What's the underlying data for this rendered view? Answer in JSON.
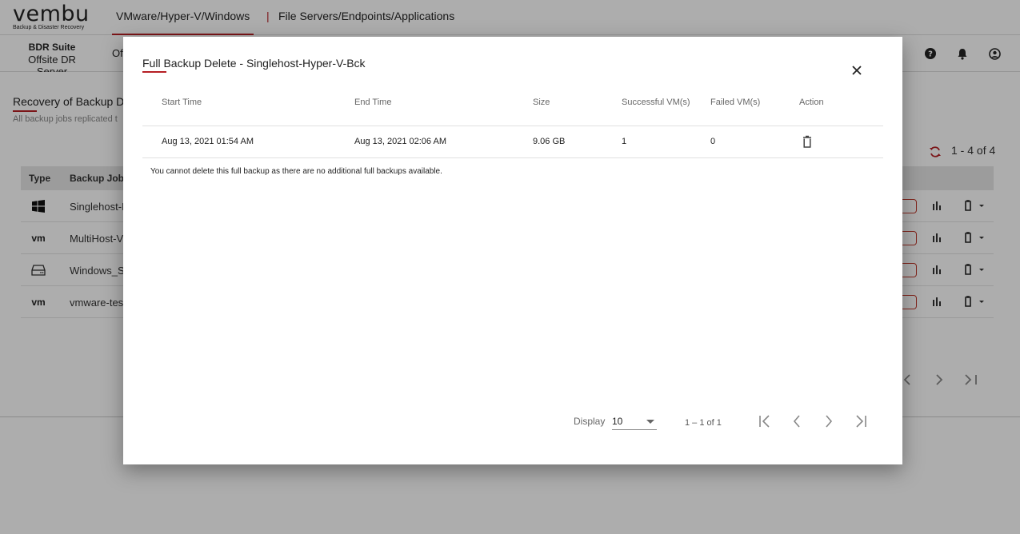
{
  "topbar": {
    "logo_word": "vembu",
    "logo_tagline": "Backup & Disaster Recovery",
    "nav_active": "VMware/Hyper-V/Windows",
    "nav_separator": "|",
    "nav_other": "File Servers/Endpoints/Applications"
  },
  "subbar": {
    "product_title": "BDR Suite",
    "product_subtitle": "Offsite DR Server",
    "tab_partial": "Of",
    "icons": [
      "help-icon",
      "bell-icon",
      "user-icon"
    ]
  },
  "background_page": {
    "title_partial": "Recovery of Backup Da",
    "subtitle_partial": "All backup jobs replicated t",
    "count_text": "1 - 4 of 4",
    "columns": [
      "Type",
      "Backup Job N"
    ],
    "rows": [
      {
        "type_icon": "windows-icon",
        "name_partial": "Singlehost-I"
      },
      {
        "type_icon": "vmware-icon",
        "type_text": "vm",
        "name_partial": "MultiHost-V"
      },
      {
        "type_icon": "drive-icon",
        "name_partial": "Windows_S"
      },
      {
        "type_icon": "vmware-icon",
        "type_text": "vm",
        "name_partial": "vmware-tes"
      }
    ]
  },
  "modal": {
    "title": "Full Backup Delete - Singlehost-Hyper-V-Bck",
    "columns": [
      "Start Time",
      "End Time",
      "Size",
      "Successful VM(s)",
      "Failed VM(s)",
      "Action"
    ],
    "rows": [
      {
        "start_time": "Aug 13, 2021 01:54 AM",
        "end_time": "Aug 13, 2021 02:06 AM",
        "size": "9.06 GB",
        "successful_vms": "1",
        "failed_vms": "0",
        "action_icon": "trash-icon"
      }
    ],
    "note": "You cannot delete this full backup as there are no additional full backups available.",
    "footer": {
      "display_label": "Display",
      "page_size": "10",
      "range_text": "1 – 1 of 1"
    }
  },
  "colors": {
    "accent": "#b61f24",
    "overlay": "rgba(0,0,0,0.32)"
  }
}
